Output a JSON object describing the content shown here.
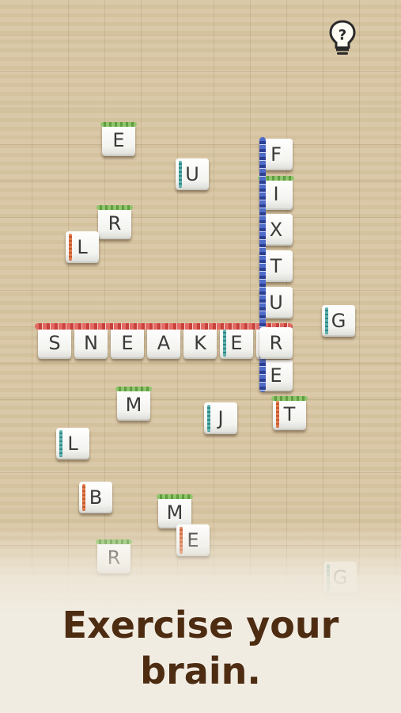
{
  "hint": {
    "icon": "lightbulb-question-icon"
  },
  "scattered_tiles": [
    {
      "letter": "E"
    },
    {
      "letter": "U"
    },
    {
      "letter": "R"
    },
    {
      "letter": "L"
    },
    {
      "letter": "G"
    },
    {
      "letter": "M"
    },
    {
      "letter": "J"
    },
    {
      "letter": "T"
    },
    {
      "letter": "L"
    },
    {
      "letter": "B"
    },
    {
      "letter": "M"
    },
    {
      "letter": "E"
    },
    {
      "letter": "R"
    },
    {
      "letter": "G"
    }
  ],
  "words": {
    "horizontal": {
      "word": "SNEAKER",
      "letters": [
        "S",
        "N",
        "E",
        "A",
        "K",
        "E",
        "R"
      ]
    },
    "vertical": {
      "word": "FIXTURE",
      "letters": [
        "F",
        "I",
        "X",
        "T",
        "U",
        "R",
        "E"
      ]
    }
  },
  "caption": {
    "line1": "Exercise your",
    "line2": "brain."
  },
  "colors": {
    "caption": "#4d2c12",
    "horizontal_rope": "#e26a62",
    "vertical_rope": "#2b3f93"
  }
}
